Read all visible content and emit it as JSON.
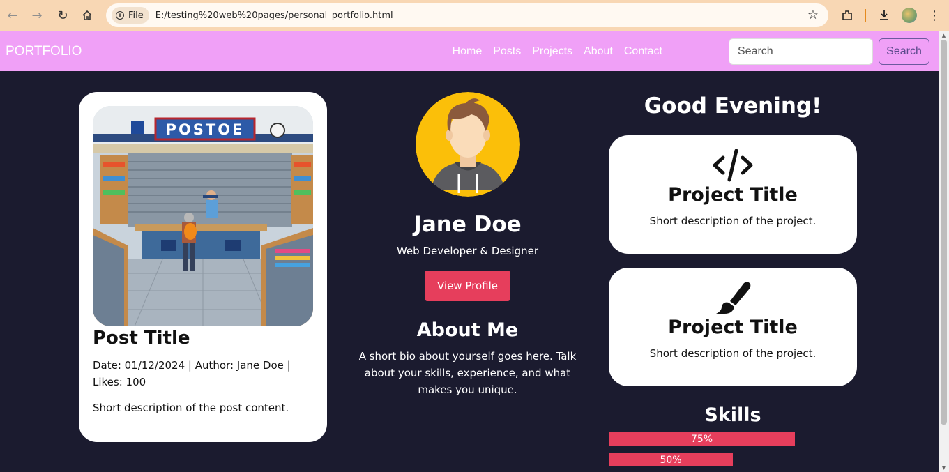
{
  "browser": {
    "file_chip": "File",
    "url": "E:/testing%20web%20pages/personal_portfolio.html"
  },
  "navbar": {
    "brand": "PORTFOLIO",
    "links": [
      "Home",
      "Posts",
      "Projects",
      "About",
      "Contact"
    ],
    "search_placeholder": "Search",
    "search_button": "Search"
  },
  "post": {
    "image_sign": "POSTOE",
    "title": "Post Title",
    "meta": "Date: 01/12/2024 | Author: Jane Doe | Likes: 100",
    "description": "Short description of the post content."
  },
  "profile": {
    "name": "Jane Doe",
    "role": "Web Developer & Designer",
    "button": "View Profile",
    "about_title": "About Me",
    "about_text": "A short bio about yourself goes here. Talk about your skills, experience, and what makes you unique."
  },
  "greeting": "Good Evening!",
  "projects": [
    {
      "icon": "code-icon",
      "title": "Project Title",
      "description": "Short description of the project."
    },
    {
      "icon": "paintbrush-icon",
      "title": "Project Title",
      "description": "Short description of the project."
    }
  ],
  "skills": {
    "title": "Skills",
    "items": [
      {
        "label": "75%",
        "value": 75
      },
      {
        "label": "50%",
        "value": 50
      }
    ]
  },
  "colors": {
    "navbar": "#f0a0f7",
    "background": "#1b1b2f",
    "accent": "#e63e5c",
    "avatar_bg": "#fbbf09"
  }
}
